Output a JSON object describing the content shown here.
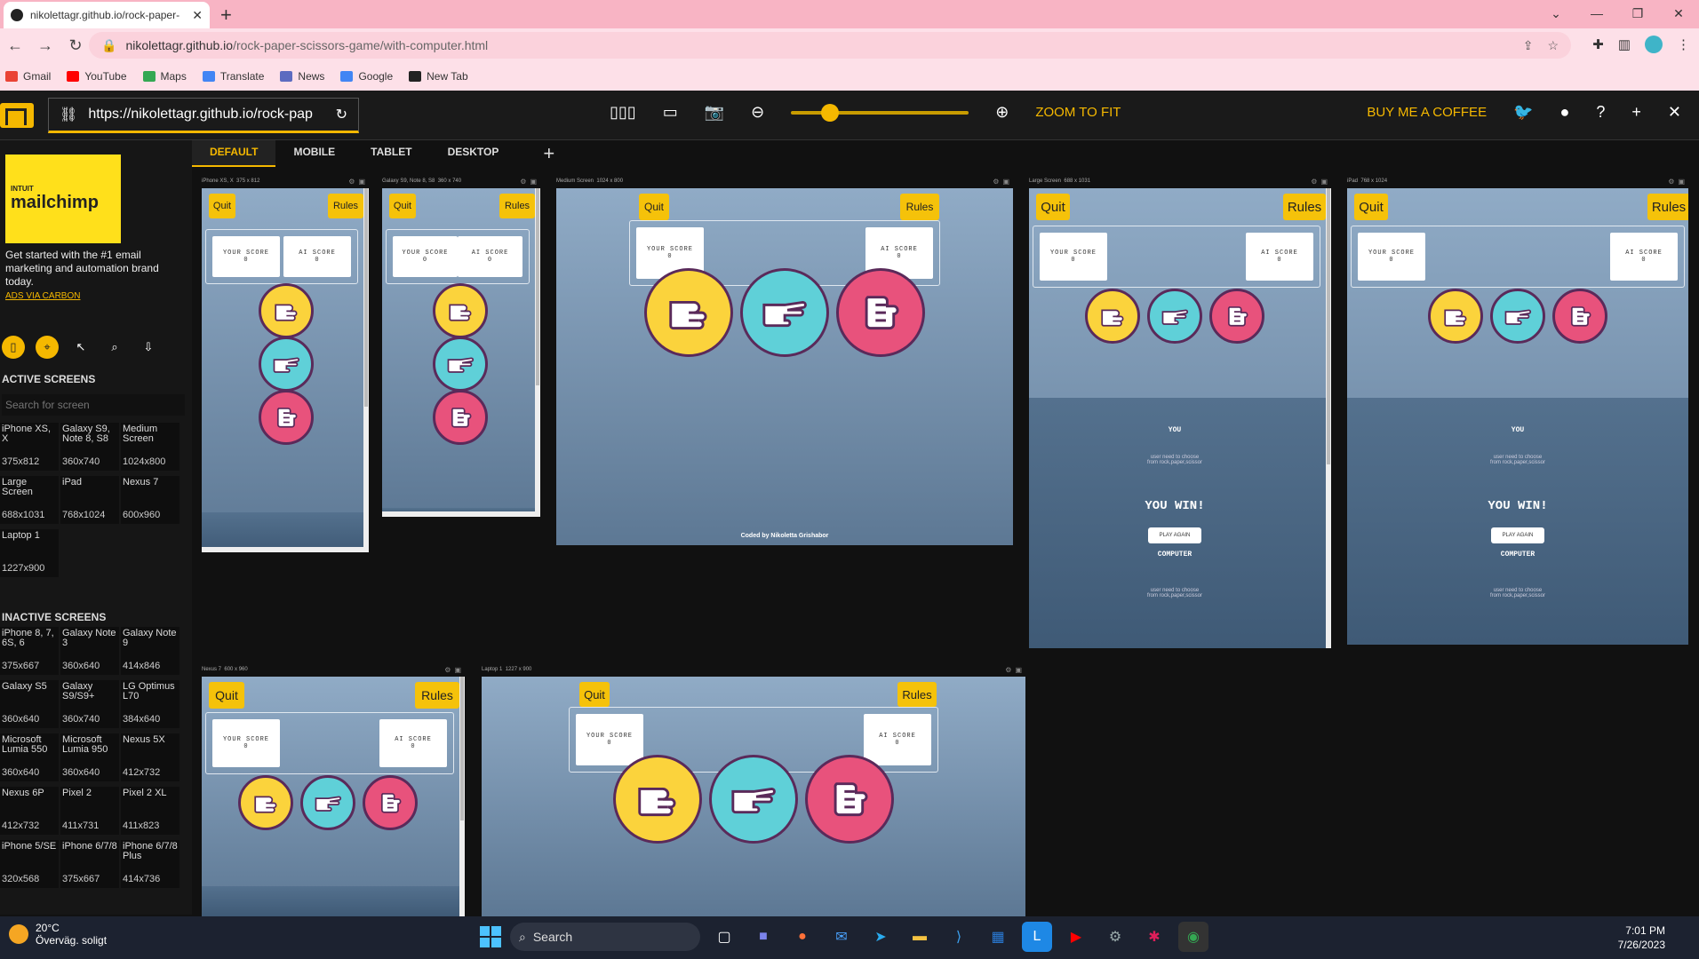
{
  "browser": {
    "tab_title": "nikolettagr.github.io/rock-paper-",
    "url_host": "nikolettagr.github.io",
    "url_path": "/rock-paper-scissors-game/with-computer.html",
    "bookmarks": [
      {
        "label": "Gmail",
        "color": "#ea4335"
      },
      {
        "label": "YouTube",
        "color": "#ff0000"
      },
      {
        "label": "Maps",
        "color": "#34a853"
      },
      {
        "label": "Translate",
        "color": "#4285f4"
      },
      {
        "label": "News",
        "color": "#5c6bc0"
      },
      {
        "label": "Google",
        "color": "#4285f4"
      },
      {
        "label": "New Tab",
        "color": "#222222"
      }
    ]
  },
  "app": {
    "url": "https://nikolettagr.github.io/rock-pap",
    "zoom_label": "ZOOM TO FIT",
    "coffee_label": "BUY ME A COFFEE",
    "zoom_level": 0.17
  },
  "sidebar": {
    "ad_brand_top": "INTUIT",
    "ad_brand": "mailchimp",
    "ad_text": "Get started with the #1 email marketing and automation brand today.",
    "ad_link": "ADS VIA CARBON",
    "active_heading": "ACTIVE SCREENS",
    "search_placeholder": "Search for screen",
    "inactive_heading": "INACTIVE SCREENS",
    "active_screens": [
      {
        "name": "iPhone XS, X",
        "size": "375x812"
      },
      {
        "name": "Galaxy S9, Note 8, S8",
        "size": "360x740"
      },
      {
        "name": "Medium Screen",
        "size": "1024x800"
      },
      {
        "name": "Large Screen",
        "size": "688x1031"
      },
      {
        "name": "iPad",
        "size": "768x1024"
      },
      {
        "name": "Nexus 7",
        "size": "600x960"
      },
      {
        "name": "Laptop 1",
        "size": "1227x900"
      }
    ],
    "inactive_screens": [
      {
        "name": "iPhone 8, 7, 6S, 6",
        "size": "375x667"
      },
      {
        "name": "Galaxy Note 3",
        "size": "360x640"
      },
      {
        "name": "Galaxy Note 9",
        "size": "414x846"
      },
      {
        "name": "Galaxy S5",
        "size": "360x640"
      },
      {
        "name": "Galaxy S9/S9+",
        "size": "360x740"
      },
      {
        "name": "LG Optimus L70",
        "size": "384x640"
      },
      {
        "name": "Microsoft Lumia 550",
        "size": "360x640"
      },
      {
        "name": "Microsoft Lumia 950",
        "size": "360x640"
      },
      {
        "name": "Nexus 5X",
        "size": "412x732"
      },
      {
        "name": "Nexus 6P",
        "size": "412x732"
      },
      {
        "name": "Pixel 2",
        "size": "411x731"
      },
      {
        "name": "Pixel 2 XL",
        "size": "411x823"
      },
      {
        "name": "iPhone 5/SE",
        "size": "320x568"
      },
      {
        "name": "iPhone 6/7/8",
        "size": "375x667"
      },
      {
        "name": "iPhone 6/7/8 Plus",
        "size": "414x736"
      }
    ]
  },
  "view_tabs": [
    "DEFAULT",
    "MOBILE",
    "TABLET",
    "DESKTOP"
  ],
  "game": {
    "quit": "Quit",
    "rules": "Rules",
    "your_score": "YOUR SCORE",
    "ai_score": "AI SCORE",
    "your_value": "0",
    "ai_value": "0",
    "you": "YOU",
    "you_win": "YOU WIN!",
    "play_again": "PLAY AGAIN",
    "computer": "COMPUTER",
    "alt_text": "user need to choose from rock,paper,scissor",
    "coded_by": "Coded by Nikoletta Grishabor",
    "colors": {
      "rock": "#fbd33c",
      "paper": "#5fd0d8",
      "scissors": "#e8527c",
      "button": "#f5c20a"
    }
  },
  "devices": [
    {
      "title": "iPhone XS, X",
      "size": "375 x 812"
    },
    {
      "title": "Galaxy S9, Note 8, S8",
      "size": "360 x 740"
    },
    {
      "title": "Medium Screen",
      "size": "1024 x 800"
    },
    {
      "title": "Large Screen",
      "size": "688 x 1031"
    },
    {
      "title": "iPad",
      "size": "768 x 1024"
    },
    {
      "title": "Nexus 7",
      "size": "600 x 960"
    },
    {
      "title": "Laptop 1",
      "size": "1227 x 900"
    }
  ],
  "taskbar": {
    "temp": "20°C",
    "weather": "Överväg. soligt",
    "search": "Search",
    "time": "7:01 PM",
    "date": "7/26/2023"
  }
}
